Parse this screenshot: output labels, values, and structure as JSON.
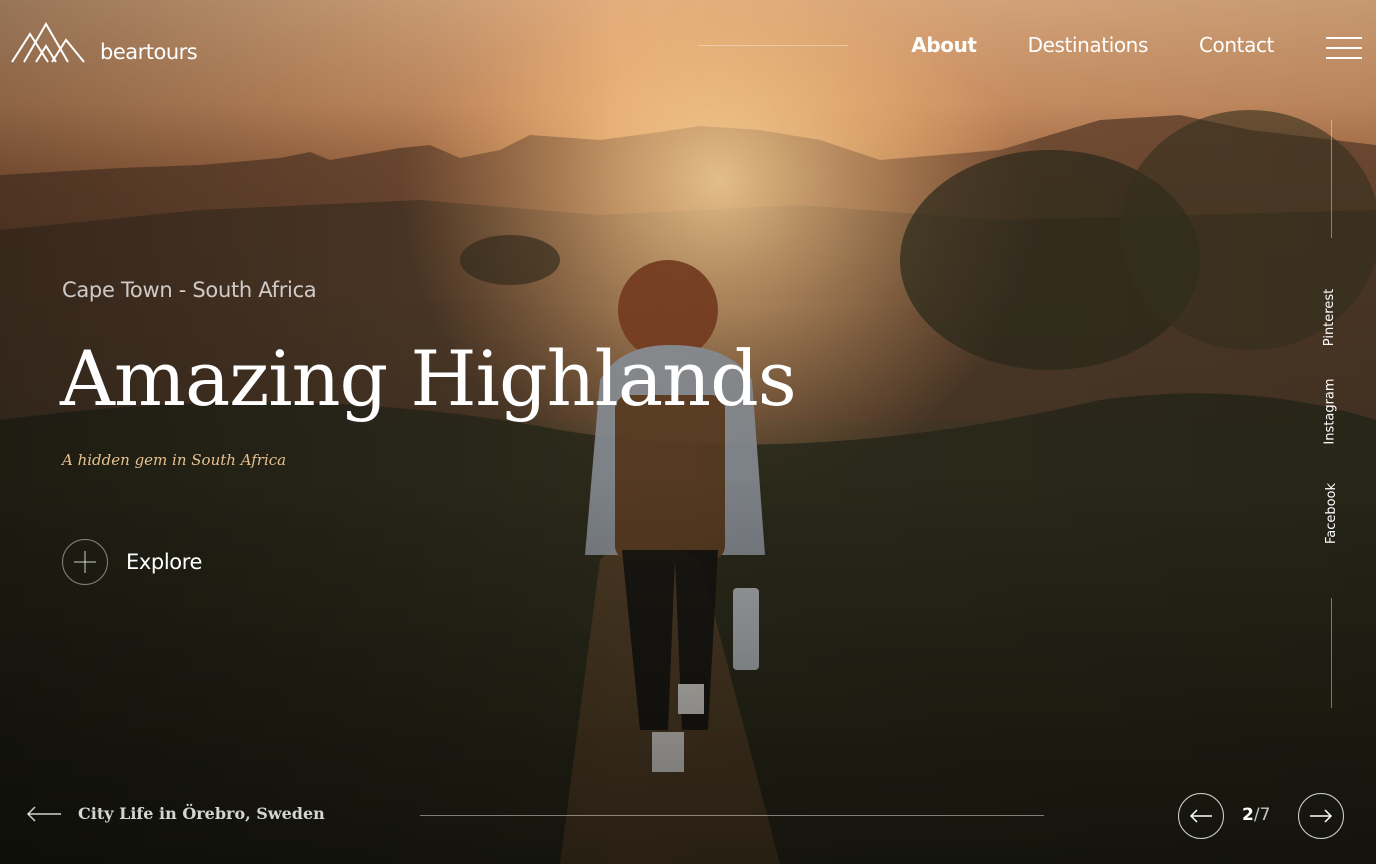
{
  "brand": {
    "name": "beartours"
  },
  "nav": {
    "items": [
      {
        "label": "About",
        "active": true
      },
      {
        "label": "Destinations",
        "active": false
      },
      {
        "label": "Contact",
        "active": false
      }
    ]
  },
  "hero": {
    "location": "Cape Town - South Africa",
    "title": "Amazing Highlands",
    "subtitle": "A hidden gem in South Africa",
    "explore_label": "Explore"
  },
  "social": {
    "pinterest": "Pinterest",
    "instagram": "Instagram",
    "facebook": "Facebook"
  },
  "slider": {
    "prev_label": "City Life in Örebro, Sweden",
    "current": "2",
    "separator": "/",
    "total": "7",
    "progress": 0.0
  },
  "icons": {
    "logo": "mountains-logo-icon",
    "menu": "hamburger-menu-icon",
    "explore": "plus-icon",
    "prev": "arrow-left-icon",
    "next": "arrow-right-icon"
  },
  "colors": {
    "accent": "#e7c08f",
    "text": "#ffffff"
  }
}
